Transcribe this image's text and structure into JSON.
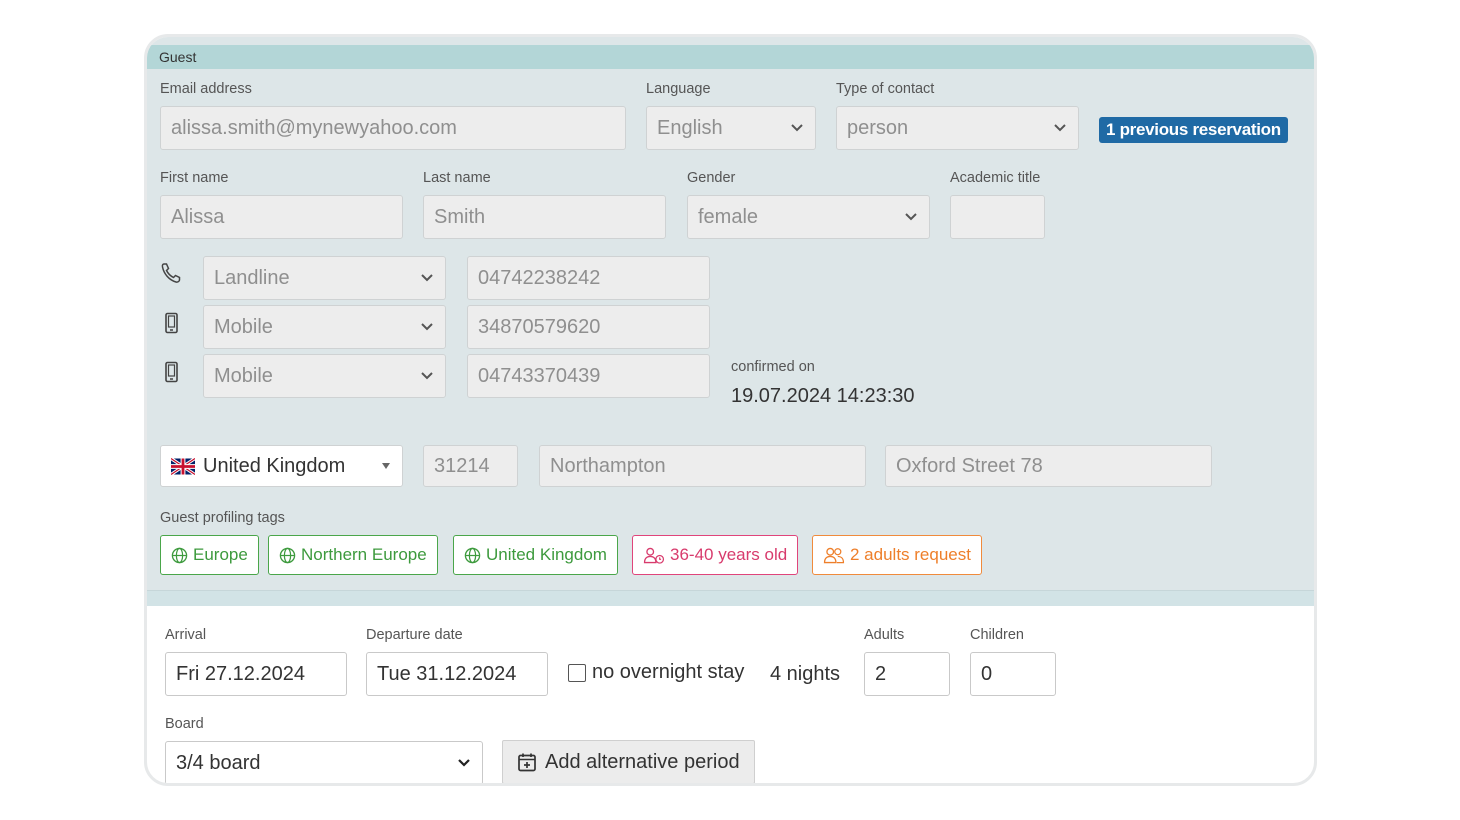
{
  "guest": {
    "section_title": "Guest",
    "email": {
      "label": "Email address",
      "value": "alissa.smith@mynewyahoo.com"
    },
    "language": {
      "label": "Language",
      "value": "English"
    },
    "contact_type": {
      "label": "Type of contact",
      "value": "person"
    },
    "previous_reservation_badge": "1 previous reservation",
    "first_name": {
      "label": "First name",
      "value": "Alissa"
    },
    "last_name": {
      "label": "Last name",
      "value": "Smith"
    },
    "gender": {
      "label": "Gender",
      "value": "female"
    },
    "academic_title": {
      "label": "Academic title",
      "value": ""
    },
    "phones": [
      {
        "icon": "phone-icon",
        "type": "Landline",
        "number": "04742238242"
      },
      {
        "icon": "mobile-phone-icon",
        "type": "Mobile",
        "number": "34870579620"
      },
      {
        "icon": "mobile-phone-icon",
        "type": "Mobile",
        "number": "04743370439"
      }
    ],
    "confirmed": {
      "label": "confirmed on",
      "value": "19.07.2024 14:23:30"
    },
    "address": {
      "country": "United Kingdom",
      "country_flag": "uk-flag-icon",
      "zip": "31214",
      "city": "Northampton",
      "street": "Oxford Street 78"
    },
    "profiling": {
      "label": "Guest profiling tags",
      "tags": [
        {
          "text": "Europe",
          "icon": "globe-icon",
          "color": "#3d9a3d"
        },
        {
          "text": "Northern Europe",
          "icon": "globe-icon",
          "color": "#3d9a3d"
        },
        {
          "text": "United Kingdom",
          "icon": "globe-icon",
          "color": "#3d9a3d"
        },
        {
          "text": "36-40 years old",
          "icon": "person-age-icon",
          "color": "#d83b6d"
        },
        {
          "text": "2 adults request",
          "icon": "two-people-icon",
          "color": "#ee7f2a"
        }
      ]
    }
  },
  "stay": {
    "arrival": {
      "label": "Arrival",
      "value": "Fri 27.12.2024"
    },
    "departure": {
      "label": "Departure date",
      "value": "Tue 31.12.2024"
    },
    "no_overnight_label": "no overnight stay",
    "no_overnight_checked": false,
    "nights": "4 nights",
    "adults": {
      "label": "Adults",
      "value": "2"
    },
    "children": {
      "label": "Children",
      "value": "0"
    },
    "board": {
      "label": "Board",
      "value": "3/4 board"
    },
    "add_period_button": "Add alternative period"
  }
}
